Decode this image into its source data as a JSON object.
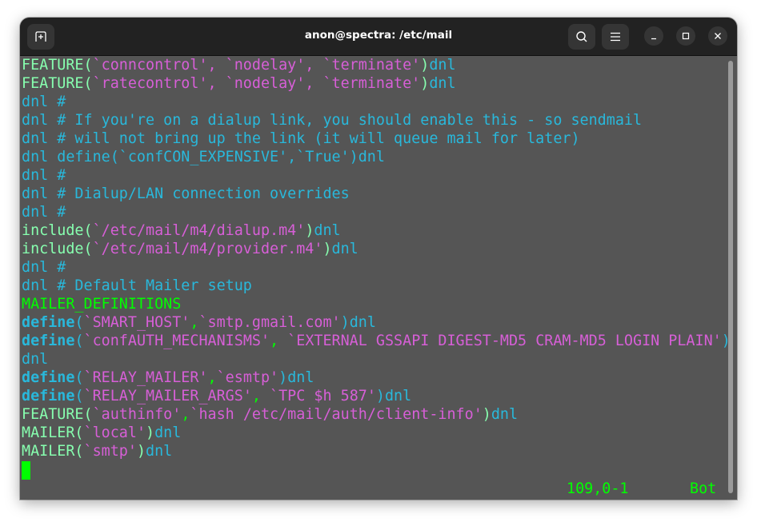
{
  "window": {
    "title": "anon@spectra: /etc/mail",
    "buttons": {
      "new_tab": "new-tab-icon",
      "search": "search-icon",
      "menu": "hamburger-menu-icon",
      "minimize": "minimize-icon",
      "maximize": "maximize-icon",
      "close": "close-icon"
    }
  },
  "colors": {
    "background": "#555555",
    "titlebar": "#222222",
    "macro": "#87ffaf",
    "string": "#d75fd7",
    "comment": "#29b8db",
    "keyword_green": "#00ff00",
    "define": "#29b8db"
  },
  "editor": {
    "lines": [
      [
        {
          "t": "FEATURE(",
          "c": "macro"
        },
        {
          "t": "`conncontrol', `nodelay', `terminate'",
          "c": "string"
        },
        {
          "t": ")",
          "c": "macro"
        },
        {
          "t": "dnl",
          "c": "comment"
        }
      ],
      [
        {
          "t": "FEATURE(",
          "c": "macro"
        },
        {
          "t": "`ratecontrol', `nodelay', `terminate'",
          "c": "string"
        },
        {
          "t": ")",
          "c": "macro"
        },
        {
          "t": "dnl",
          "c": "comment"
        }
      ],
      [
        {
          "t": "dnl #",
          "c": "comment"
        }
      ],
      [
        {
          "t": "dnl # If you're on a dialup link, you should enable this - so sendmail",
          "c": "comment"
        }
      ],
      [
        {
          "t": "dnl # will not bring up the link (it will queue mail for later)",
          "c": "comment"
        }
      ],
      [
        {
          "t": "dnl define(`confCON_EXPENSIVE',`True')dnl",
          "c": "comment"
        }
      ],
      [
        {
          "t": "dnl #",
          "c": "comment"
        }
      ],
      [
        {
          "t": "dnl # Dialup/LAN connection overrides",
          "c": "comment"
        }
      ],
      [
        {
          "t": "dnl #",
          "c": "comment"
        }
      ],
      [
        {
          "t": "include(",
          "c": "macro"
        },
        {
          "t": "`/etc/mail/m4/dialup.m4'",
          "c": "string"
        },
        {
          "t": ")",
          "c": "macro"
        },
        {
          "t": "dnl",
          "c": "comment"
        }
      ],
      [
        {
          "t": "include(",
          "c": "macro"
        },
        {
          "t": "`/etc/mail/m4/provider.m4'",
          "c": "string"
        },
        {
          "t": ")",
          "c": "macro"
        },
        {
          "t": "dnl",
          "c": "comment"
        }
      ],
      [
        {
          "t": "dnl #",
          "c": "comment"
        }
      ],
      [
        {
          "t": "dnl # Default Mailer setup",
          "c": "comment"
        }
      ],
      [
        {
          "t": "MAILER_DEFINITIONS",
          "c": "keyword_green"
        }
      ],
      [
        {
          "t": "define",
          "c": "define",
          "b": true
        },
        {
          "t": "(",
          "c": "define"
        },
        {
          "t": "`SMART_HOST'",
          "c": "string"
        },
        {
          "t": ",",
          "c": "keyword_green"
        },
        {
          "t": "`smtp.gmail.com'",
          "c": "string"
        },
        {
          "t": ")",
          "c": "define"
        },
        {
          "t": "dnl",
          "c": "comment"
        }
      ],
      [
        {
          "t": "define",
          "c": "define",
          "b": true
        },
        {
          "t": "(",
          "c": "define"
        },
        {
          "t": "`confAUTH_MECHANISMS'",
          "c": "string"
        },
        {
          "t": ",",
          "c": "keyword_green"
        },
        {
          "t": " `EXTERNAL GSSAPI DIGEST-MD5 CRAM-MD5 LOGIN PLAIN'",
          "c": "string"
        },
        {
          "t": ")",
          "c": "define"
        }
      ],
      [
        {
          "t": "dnl",
          "c": "comment"
        }
      ],
      [
        {
          "t": "define",
          "c": "define",
          "b": true
        },
        {
          "t": "(",
          "c": "define"
        },
        {
          "t": "`RELAY_MAILER'",
          "c": "string"
        },
        {
          "t": ",",
          "c": "keyword_green"
        },
        {
          "t": "`esmtp'",
          "c": "string"
        },
        {
          "t": ")",
          "c": "define"
        },
        {
          "t": "dnl",
          "c": "comment"
        }
      ],
      [
        {
          "t": "define",
          "c": "define",
          "b": true
        },
        {
          "t": "(",
          "c": "define"
        },
        {
          "t": "`RELAY_MAILER_ARGS'",
          "c": "string"
        },
        {
          "t": ",",
          "c": "keyword_green"
        },
        {
          "t": " `TPC $h 587'",
          "c": "string"
        },
        {
          "t": ")",
          "c": "define"
        },
        {
          "t": "dnl",
          "c": "comment"
        }
      ],
      [
        {
          "t": "FEATURE(",
          "c": "macro"
        },
        {
          "t": "`authinfo'",
          "c": "string"
        },
        {
          "t": ",",
          "c": "keyword_green"
        },
        {
          "t": "`hash /etc/mail/auth/client-info'",
          "c": "string"
        },
        {
          "t": ")",
          "c": "macro"
        },
        {
          "t": "dnl",
          "c": "comment"
        }
      ],
      [
        {
          "t": "MAILER(",
          "c": "macro"
        },
        {
          "t": "`local'",
          "c": "string"
        },
        {
          "t": ")",
          "c": "macro"
        },
        {
          "t": "dnl",
          "c": "comment"
        }
      ],
      [
        {
          "t": "MAILER(",
          "c": "macro"
        },
        {
          "t": "`smtp'",
          "c": "string"
        },
        {
          "t": ")",
          "c": "macro"
        },
        {
          "t": "dnl",
          "c": "comment"
        }
      ]
    ],
    "status": {
      "position": "109,0-1",
      "scroll": "Bot"
    }
  }
}
